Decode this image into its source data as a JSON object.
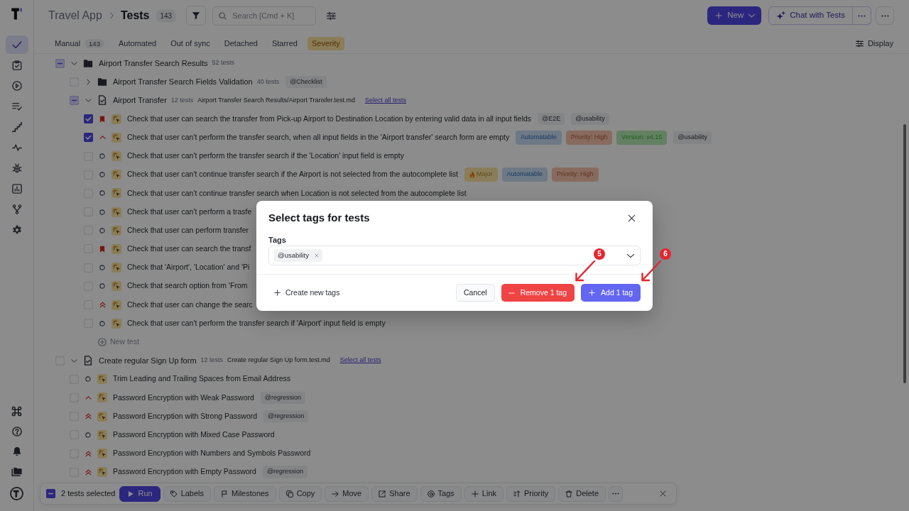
{
  "sidebar": {
    "items": [
      {
        "selected": true
      },
      {
        "selected": false
      },
      {
        "selected": false
      },
      {
        "selected": false
      },
      {
        "selected": false
      },
      {
        "selected": false
      },
      {
        "selected": false
      },
      {
        "selected": false
      },
      {
        "selected": false
      },
      {
        "selected": false
      }
    ]
  },
  "header": {
    "breadcrumb": [
      {
        "label": "Travel App"
      },
      {
        "label": "Tests"
      }
    ],
    "count": "143",
    "search": {
      "placeholder": "Search [Cmd + K]"
    },
    "new_button": "New",
    "chat_button": "Chat with Tests"
  },
  "tabs": [
    {
      "label": "Manual",
      "count": "143",
      "selected": false
    },
    {
      "label": "Automated",
      "selected": false
    },
    {
      "label": "Out of sync",
      "selected": false
    },
    {
      "label": "Detached",
      "selected": false
    },
    {
      "label": "Starred",
      "selected": false
    },
    {
      "label": "Severity",
      "selected": true
    }
  ],
  "display_button": "Display",
  "tree": [
    {
      "kind": "folder",
      "title": "Airport Transfer Search Results",
      "count": "52 tests",
      "checked": false,
      "indeterminate": true,
      "expanded": true,
      "children": [
        {
          "kind": "folder",
          "title": "Airport Transfer Search Fields Validation",
          "count": "40 tests",
          "checked": false,
          "indeterminate": false,
          "expanded": false,
          "tags": [
            "@Checklist"
          ]
        },
        {
          "kind": "file",
          "title": "Airport Transfer",
          "count": "12 tests",
          "path": "Airport Transfer Search Results/Airport Transfer.test.md",
          "link": "Select all tests",
          "checked": false,
          "indeterminate": true,
          "expanded": true,
          "children": [
            {
              "kind": "test",
              "title": "Check that user can search the transfer from Pick-up Airport to Destination Location by entering valid data in all input fields",
              "priority": {
                "kind": "critical"
              },
              "checked": true,
              "tags": [
                "@E2E",
                "@usability"
              ]
            },
            {
              "kind": "test",
              "title": "Check that user can't perform the transfer search, when all input fields in the 'Airport transfer' search form are empty",
              "priority": {
                "kind": "important"
              },
              "checked": true,
              "labels": [
                {
                  "kind": "label",
                  "text": "Automatable",
                  "color": "#6e7986"
                },
                {
                  "kind": "label",
                  "text": "Priority: High",
                  "color": "#886b5f"
                },
                {
                  "kind": "label",
                  "text": "Version: v4.15",
                  "color": "#648062"
                }
              ],
              "tags": [
                "@usability"
              ]
            },
            {
              "kind": "test",
              "title": "Check that user can't perform the transfer search if the 'Location' input field is empty",
              "priority": {
                "kind": "normal"
              },
              "checked": false
            },
            {
              "kind": "test",
              "title": "Check that user can't continue transfer search if the Airport is not selected from the autocomplete list",
              "priority": {
                "kind": "normal"
              },
              "checked": false,
              "labels": [
                {
                  "kind": "severity",
                  "text": "Major",
                  "color": "#8a7d59"
                },
                {
                  "kind": "label",
                  "text": "Automatable",
                  "color": "#6e7986"
                },
                {
                  "kind": "label",
                  "text": "Priority: High",
                  "color": "#886b5f"
                }
              ]
            },
            {
              "kind": "test",
              "title": "Check that user can't continue transfer search when Location is not selected from the autocomplete list",
              "priority": {
                "kind": "normal"
              },
              "checked": false
            },
            {
              "kind": "test",
              "title": "Check that user can't perform a trasfe",
              "priority": {
                "kind": "normal"
              },
              "checked": false
            },
            {
              "kind": "test",
              "title": "Check that user can perform transfer",
              "priority": {
                "kind": "normal"
              },
              "checked": false
            },
            {
              "kind": "test",
              "title": "Check that user can search the transf",
              "priority": {
                "kind": "critical"
              },
              "checked": false
            },
            {
              "kind": "test",
              "title": "Check that 'Airport', 'Location' and 'Pi",
              "priority": {
                "kind": "normal"
              },
              "checked": false
            },
            {
              "kind": "test",
              "title": "Check that search option from 'From",
              "priority": {
                "kind": "normal"
              },
              "checked": false
            },
            {
              "kind": "test",
              "title": "Check that user can change the searc",
              "priority": {
                "kind": "high"
              },
              "checked": false
            },
            {
              "kind": "test",
              "title": "Check that user can't perform the transfer search if 'Airport' input field is empty",
              "priority": {
                "kind": "normal"
              },
              "checked": false
            },
            {
              "kind": "new",
              "title": "New test"
            }
          ]
        }
      ]
    },
    {
      "kind": "file",
      "title": "Create regular Sign Up form",
      "count": "12 tests",
      "path": "Create regular Sign Up form.test.md",
      "link": "Select all tests",
      "checked": false,
      "indeterminate": false,
      "expanded": true,
      "children": [
        {
          "kind": "test",
          "title": "Trim Leading and Trailing Spaces from Email Address",
          "priority": {
            "kind": "normal"
          },
          "checked": false
        },
        {
          "kind": "test",
          "title": "Password Encryption with Weak Password",
          "priority": {
            "kind": "important"
          },
          "checked": false,
          "tags": [
            "@regression"
          ]
        },
        {
          "kind": "test",
          "title": "Password Encryption with Strong Password",
          "priority": {
            "kind": "high"
          },
          "checked": false,
          "tags": [
            "@regression"
          ]
        },
        {
          "kind": "test",
          "title": "Password Encryption with Mixed Case Password",
          "priority": {
            "kind": "normal"
          },
          "checked": false
        },
        {
          "kind": "test",
          "title": "Password Encryption with Numbers and Symbols Password",
          "priority": {
            "kind": "high"
          },
          "checked": false
        },
        {
          "kind": "test",
          "title": "Password Encryption with Empty Password",
          "priority": {
            "kind": "high"
          },
          "checked": false,
          "tags": [
            "@regression"
          ]
        }
      ]
    }
  ],
  "selection_bar": {
    "checked": true,
    "indeterminate": true,
    "label": "2 tests selected",
    "actions": [
      {
        "label": "Run",
        "kind": "primary"
      },
      {
        "label": "Labels",
        "kind": "default"
      },
      {
        "label": "Milestones",
        "kind": "default"
      },
      {
        "label": "Copy",
        "kind": "default"
      },
      {
        "label": "Move",
        "kind": "default"
      },
      {
        "label": "Share",
        "kind": "default"
      },
      {
        "label": "Tags",
        "kind": "default"
      },
      {
        "label": "Link",
        "kind": "default"
      },
      {
        "label": "Priority",
        "kind": "default"
      },
      {
        "label": "Delete",
        "kind": "default"
      }
    ]
  },
  "modal": {
    "title": "Select tags for tests",
    "field": {
      "label": "Tags",
      "chips": [
        "@usability"
      ]
    },
    "create_button": "Create new tags",
    "buttons": [
      {
        "label": "Cancel",
        "kind": "secondary"
      },
      {
        "label": "Remove 1 tag",
        "kind": "danger"
      },
      {
        "label": "Add 1 tag",
        "kind": "primary"
      }
    ]
  },
  "annotations": [
    {
      "label": "5"
    },
    {
      "label": "6"
    }
  ]
}
